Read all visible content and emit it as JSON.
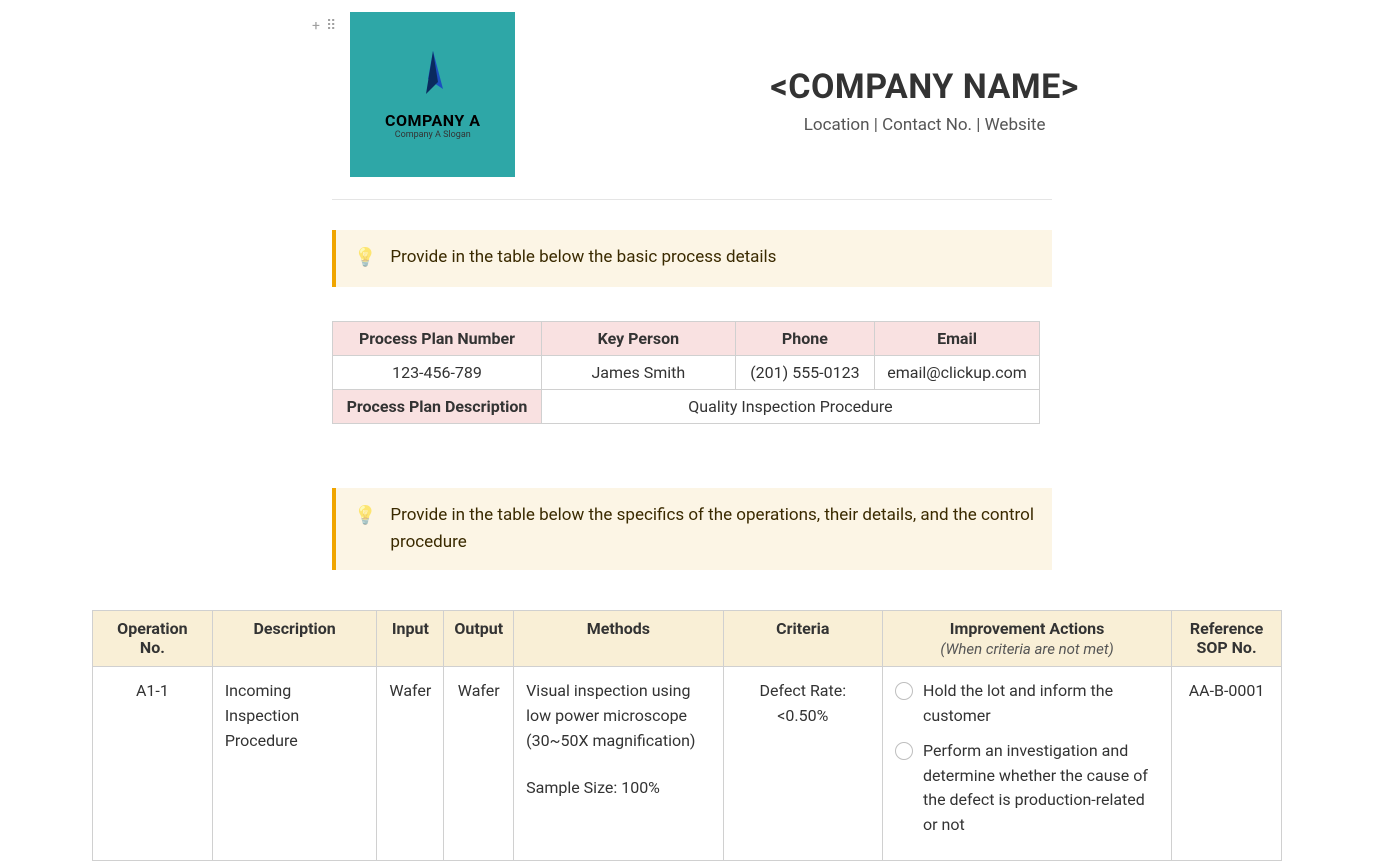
{
  "block_controls": {
    "add": "+",
    "drag": "⠿"
  },
  "logo": {
    "company_text": "COMPANY A",
    "slogan": "Company A Slogan"
  },
  "header": {
    "company_name": "<COMPANY NAME>",
    "contact_line": "Location | Contact No. | Website"
  },
  "callouts": {
    "c1": "Provide in the table below the basic process details",
    "c2": "Provide in the table below the specifics of the operations, their details, and the control procedure"
  },
  "process_table": {
    "headers": {
      "plan_number": "Process Plan Number",
      "key_person": "Key Person",
      "phone": "Phone",
      "email": "Email",
      "description": "Process Plan Description"
    },
    "values": {
      "plan_number": "123-456-789",
      "key_person": "James Smith",
      "phone": "(201) 555-0123",
      "email": "email@clickup.com",
      "description": "Quality Inspection Procedure"
    }
  },
  "ops_table": {
    "headers": {
      "op_no": "Operation No.",
      "description": "Description",
      "input": "Input",
      "output": "Output",
      "methods": "Methods",
      "criteria": "Criteria",
      "actions": "Improvement Actions",
      "actions_sub": "(When criteria are not met)",
      "ref_sop": "Reference SOP No."
    },
    "rows": [
      {
        "op_no": "A1-1",
        "description": "Incoming Inspection Procedure",
        "input": "Wafer",
        "output": "Wafer",
        "methods_line1": "Visual inspection using low power microscope (30~50X magnification)",
        "methods_line2": "Sample Size: 100%",
        "criteria_line1": "Defect Rate:",
        "criteria_line2": "<0.50%",
        "actions": [
          "Hold the lot and inform the customer",
          "Perform an investigation and determine whether the cause of the defect is production-related or not"
        ],
        "ref_sop": "AA-B-0001"
      }
    ]
  }
}
